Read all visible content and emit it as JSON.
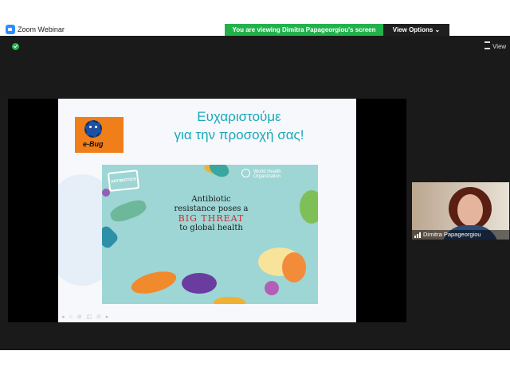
{
  "app": {
    "title": "Zoom Webinar"
  },
  "banner": {
    "viewing_text": "You are viewing Dimitra Papageorgiou's screen",
    "view_options_label": "View Options ⌄"
  },
  "toolbar": {
    "view_label": "View"
  },
  "slide": {
    "logo_text": "e-Bug",
    "heading_line1": "Ευχαριστούμε",
    "heading_line2": "για την προσοχή σας!",
    "poster": {
      "badge": "ANTIBIOTICS",
      "org_line1": "World Health",
      "org_line2": "Organization",
      "text_line1": "Antibiotic",
      "text_line2": "resistance poses a",
      "text_big": "BIG THREAT",
      "text_line4": "to global health"
    }
  },
  "participant": {
    "name": "Dimitra Papageorgiou"
  },
  "colors": {
    "accent_green": "#22b24c",
    "heading_teal": "#19a8b8",
    "threat_red": "#d6262b",
    "logo_orange": "#f07e19"
  }
}
